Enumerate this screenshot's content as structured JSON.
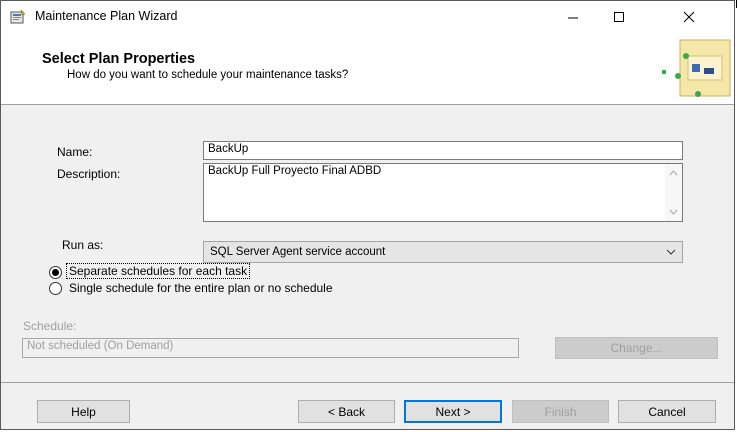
{
  "window": {
    "title": "Maintenance Plan Wizard",
    "icon": "wizard-icon"
  },
  "header": {
    "title": "Select Plan Properties",
    "subtitle": "How do you want to schedule your maintenance tasks?"
  },
  "form": {
    "name_label": "Name:",
    "name_value": "BackUp",
    "description_label": "Description:",
    "description_value": "BackUp Full Proyecto Final ADBD",
    "run_as_label": "Run as:",
    "run_as_value": "SQL Server Agent service account"
  },
  "schedule_options": {
    "separate_label": "Separate schedules for each task",
    "separate_selected": true,
    "single_label": "Single schedule for the entire plan or no schedule",
    "single_selected": false
  },
  "schedule": {
    "label": "Schedule:",
    "value": "Not scheduled (On Demand)",
    "change_button": "Change..."
  },
  "footer": {
    "help": "Help",
    "back": "< Back",
    "next": "Next >",
    "finish": "Finish",
    "cancel": "Cancel"
  },
  "colors": {
    "accent": "#0078d7",
    "dialog_bg": "#f0f0f0"
  }
}
